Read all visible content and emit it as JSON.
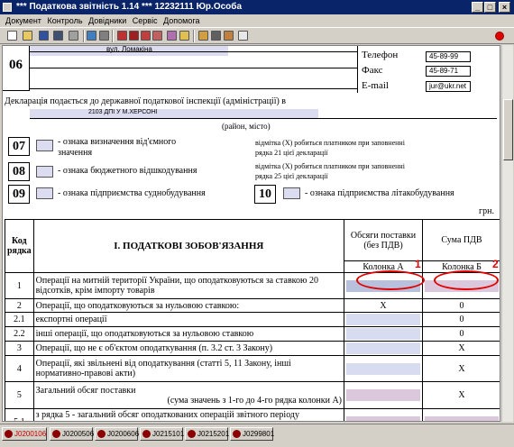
{
  "window": {
    "title": "*** Податкова звітність 1.14 *** 12232111 Юр.Особа"
  },
  "menu": [
    "Документ",
    "Контроль",
    "Довідники",
    "Сервіс",
    "Допомога"
  ],
  "header": {
    "row06": "06",
    "street": "вул. Ломакіна",
    "phone_label": "Телефон",
    "phone": "45-89-99",
    "fax_label": "Факс",
    "fax": "45-89-71",
    "email_label": "E-mail",
    "email": "jur@ukr.net",
    "decl_text": "Декларація подається до державної податкової інспекції (адміністрації) в",
    "inspection": "2103 ДПІ У М.ХЕРСОНІ",
    "district_hint": "(район, місто)"
  },
  "flags": {
    "f07": {
      "num": "07",
      "label": "- ознака визначення від'ємного значення",
      "note": "відмітка (Х) робиться платником при заповненні рядка 21 цієї декларації"
    },
    "f08": {
      "num": "08",
      "label": "- ознака бюджетного відшкодування",
      "note": "відмітка (Х) робиться платником при заповненні рядка 25 цієї декларації"
    },
    "f09": {
      "num": "09",
      "label": "- ознака підприємства суднобудування"
    },
    "f10": {
      "num": "10",
      "label": "- ознака підприємства літакобудування"
    }
  },
  "currency": "грн.",
  "table": {
    "col_code": "Код рядка",
    "col_section": "І. ПОДАТКОВІ ЗОБОВ'ЯЗАННЯ",
    "col_a": "Обсяги поставки (без ПДВ)",
    "col_b": "Сума ПДВ",
    "col_a_sub": "Колонка А",
    "col_b_sub": "Колонка Б",
    "rows": [
      {
        "code": "1",
        "text": "Операції на митній території України, що оподатковуються за ставкою 20 відсотків, крім імпорту товарів",
        "a": "",
        "b": ""
      },
      {
        "code": "2",
        "text": "Операції, що оподатковуються за нульовою ставкою:",
        "a": "X",
        "b": "0"
      },
      {
        "code": "2.1",
        "text": "експортні операції",
        "a": "",
        "b": "0"
      },
      {
        "code": "2.2",
        "text": "інші операції, що оподатковуються за нульовою ставкою",
        "a": "",
        "b": "0"
      },
      {
        "code": "3",
        "text": "Операції, що не є об'єктом оподаткування (п. 3.2 ст. 3 Закону)",
        "a": "",
        "b": "X"
      },
      {
        "code": "4",
        "text": "Операції, які звільнені від оподаткування (статті 5, 11 Закону, інші нормативно-правові акти)",
        "a": "",
        "b": "X"
      },
      {
        "code": "5",
        "text": "Загальний обсяг поставки",
        "text2": "(сума значень з 1-го до 4-го рядка колонки А)",
        "a": "",
        "b": "X"
      },
      {
        "code": "5.1",
        "text": "з рядка 5 - загальний обсяг оподаткованих операцій звітного періоду",
        "a": "",
        "b": ""
      }
    ]
  },
  "annotations": {
    "marker1": "1",
    "marker2": "2"
  },
  "tabs": [
    "J0200106",
    "J0200506",
    "J0200606",
    "J0215101",
    "J0215201",
    "J0299801"
  ]
}
